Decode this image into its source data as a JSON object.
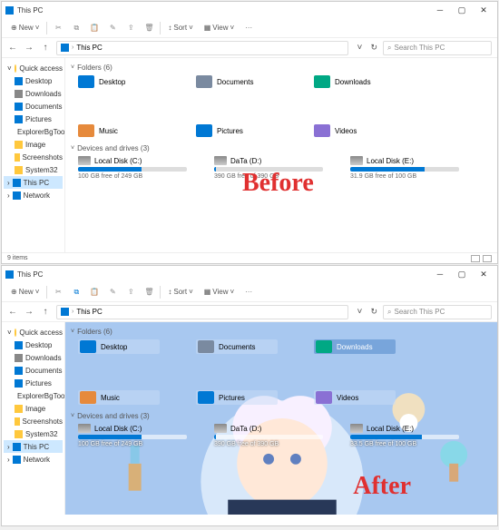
{
  "title": "This PC",
  "ribbon": {
    "new": "New",
    "sort": "Sort",
    "view": "View"
  },
  "addr": {
    "loc": "This PC",
    "search_ph": "Search This PC"
  },
  "sidebar": {
    "quick": "Quick access",
    "items": [
      {
        "label": "Desktop"
      },
      {
        "label": "Downloads"
      },
      {
        "label": "Documents"
      },
      {
        "label": "Pictures"
      },
      {
        "label": "ExplorerBgTool"
      },
      {
        "label": "Image"
      },
      {
        "label": "Screenshots"
      },
      {
        "label": "System32"
      }
    ],
    "thispc": "This PC",
    "network": "Network"
  },
  "sections": {
    "folders": "Folders (6)",
    "drives": "Devices and drives (3)"
  },
  "folders": [
    {
      "label": "Desktop",
      "color": "ic-blue"
    },
    {
      "label": "Documents",
      "color": "ic-steel"
    },
    {
      "label": "Downloads",
      "color": "ic-teal"
    },
    {
      "label": "Music",
      "color": "ic-orange"
    },
    {
      "label": "Pictures",
      "color": "ic-blue"
    },
    {
      "label": "Videos",
      "color": "ic-purple"
    }
  ],
  "drives": [
    {
      "name": "Local Disk (C:)",
      "info": "100 GB free of 249 GB",
      "pct": 58
    },
    {
      "name": "DaTa (D:)",
      "info": "390 GB free of 390 GB",
      "pct": 2
    },
    {
      "name": "Local Disk (E:)",
      "info": "31.9 GB free of 100 GB",
      "pct": 68
    }
  ],
  "drives_after": [
    {
      "name": "Local Disk (C:)",
      "info": "100 GB free of 249 GB",
      "pct": 58
    },
    {
      "name": "DaTa (D:)",
      "info": "390 GB free of 390 GB",
      "pct": 2
    },
    {
      "name": "Local Disk (E:)",
      "info": "33.5 GB free of 100 GB",
      "pct": 66
    }
  ],
  "status": {
    "items": "9 items"
  },
  "labels": {
    "before": "Before",
    "after": "After"
  }
}
